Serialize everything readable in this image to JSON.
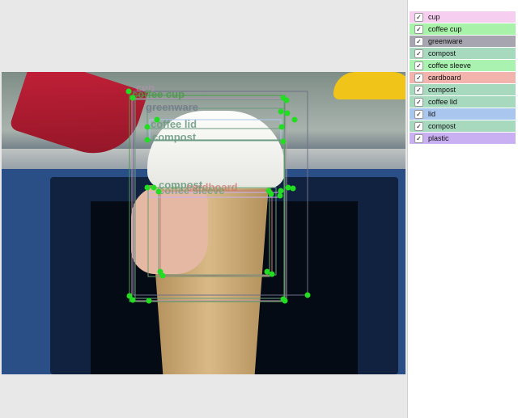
{
  "labels": [
    {
      "text": "cup",
      "color": "#f6cff0",
      "checked": true
    },
    {
      "text": "coffee cup",
      "color": "#a9f2a9",
      "checked": true
    },
    {
      "text": "greenware",
      "color": "#a7a6b0",
      "checked": true
    },
    {
      "text": "compost",
      "color": "#a6d9be",
      "checked": true
    },
    {
      "text": "coffee sleeve",
      "color": "#a9f2b0",
      "checked": true
    },
    {
      "text": "cardboard",
      "color": "#f3b4ad",
      "checked": true
    },
    {
      "text": "compost",
      "color": "#a6d9be",
      "checked": true
    },
    {
      "text": "coffee lid",
      "color": "#a6d9be",
      "checked": true
    },
    {
      "text": "lid",
      "color": "#a9c6ef",
      "checked": true
    },
    {
      "text": "compost",
      "color": "#a6d9be",
      "checked": true
    },
    {
      "text": "plastic",
      "color": "#c9b0f3",
      "checked": true
    }
  ],
  "annotations": [
    {
      "text": "cup",
      "color": "#c08fb8"
    },
    {
      "text": "coffee cup",
      "color": "#4c9a4c"
    },
    {
      "text": "greenware",
      "color": "#6f6f88"
    },
    {
      "text": "coffee lid",
      "color": "#6a9a80"
    },
    {
      "text": "compost",
      "color": "#6a9a80"
    },
    {
      "text": "compost",
      "color": "#6a9a80"
    },
    {
      "text": "cardboard",
      "color": "#c9786f"
    },
    {
      "text": "coffee sleeve",
      "color": "#6aa06a"
    }
  ],
  "checkmark": "✓",
  "handle_color": "#22dd22"
}
